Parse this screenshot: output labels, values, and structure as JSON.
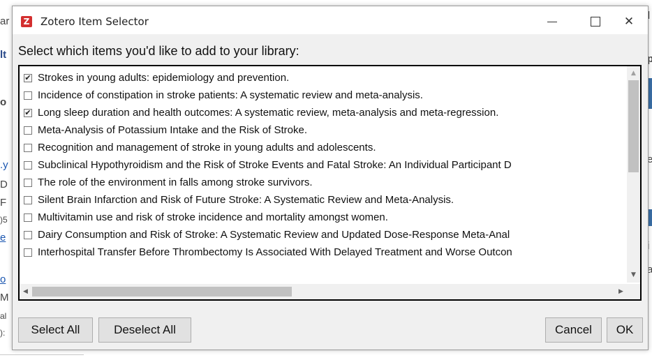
{
  "background": {
    "fragments": [
      "ar",
      "lt",
      "o",
      ".y",
      "D",
      "F",
      ")5",
      "e",
      "o",
      "M",
      "al",
      "):",
      "p",
      "e",
      "i",
      "a",
      "l"
    ]
  },
  "dialog": {
    "title": "Zotero Item Selector",
    "app_icon_letter": "Z",
    "window_controls": {
      "close_glyph": "✕"
    },
    "prompt": "Select which items you'd like to add to your library:",
    "items": [
      {
        "label": "Strokes in young adults: epidemiology and prevention.",
        "checked": true
      },
      {
        "label": "Incidence of constipation in stroke patients: A systematic review and meta-analysis.",
        "checked": false
      },
      {
        "label": "Long sleep duration and health outcomes: A systematic review, meta-analysis and meta-regression.",
        "checked": true
      },
      {
        "label": "Meta-Analysis of Potassium Intake and the Risk of Stroke.",
        "checked": false
      },
      {
        "label": "Recognition and management of stroke in young adults and adolescents.",
        "checked": false
      },
      {
        "label": "Subclinical Hypothyroidism and the Risk of Stroke Events and Fatal Stroke: An Individual Participant D",
        "checked": false
      },
      {
        "label": "The role of the environment in falls among stroke survivors.",
        "checked": false
      },
      {
        "label": "Silent Brain Infarction and Risk of Future Stroke: A Systematic Review and Meta-Analysis.",
        "checked": false
      },
      {
        "label": "Multivitamin use and risk of stroke incidence and mortality amongst women.",
        "checked": false
      },
      {
        "label": "Dairy Consumption and Risk of Stroke: A Systematic Review and Updated Dose-Response Meta-Anal",
        "checked": false
      },
      {
        "label": "Interhospital Transfer Before Thrombectomy Is Associated With Delayed Treatment and Worse Outcon",
        "checked": false
      }
    ],
    "buttons": {
      "select_all": "Select All",
      "deselect_all": "Deselect All",
      "cancel": "Cancel",
      "ok": "OK"
    }
  },
  "colors": {
    "dialog_bg": "#f0f0f0",
    "title_bg": "#ffffff",
    "app_icon": "#d32f2f",
    "list_border": "#000000",
    "scroll_thumb": "#c1c1c1"
  }
}
